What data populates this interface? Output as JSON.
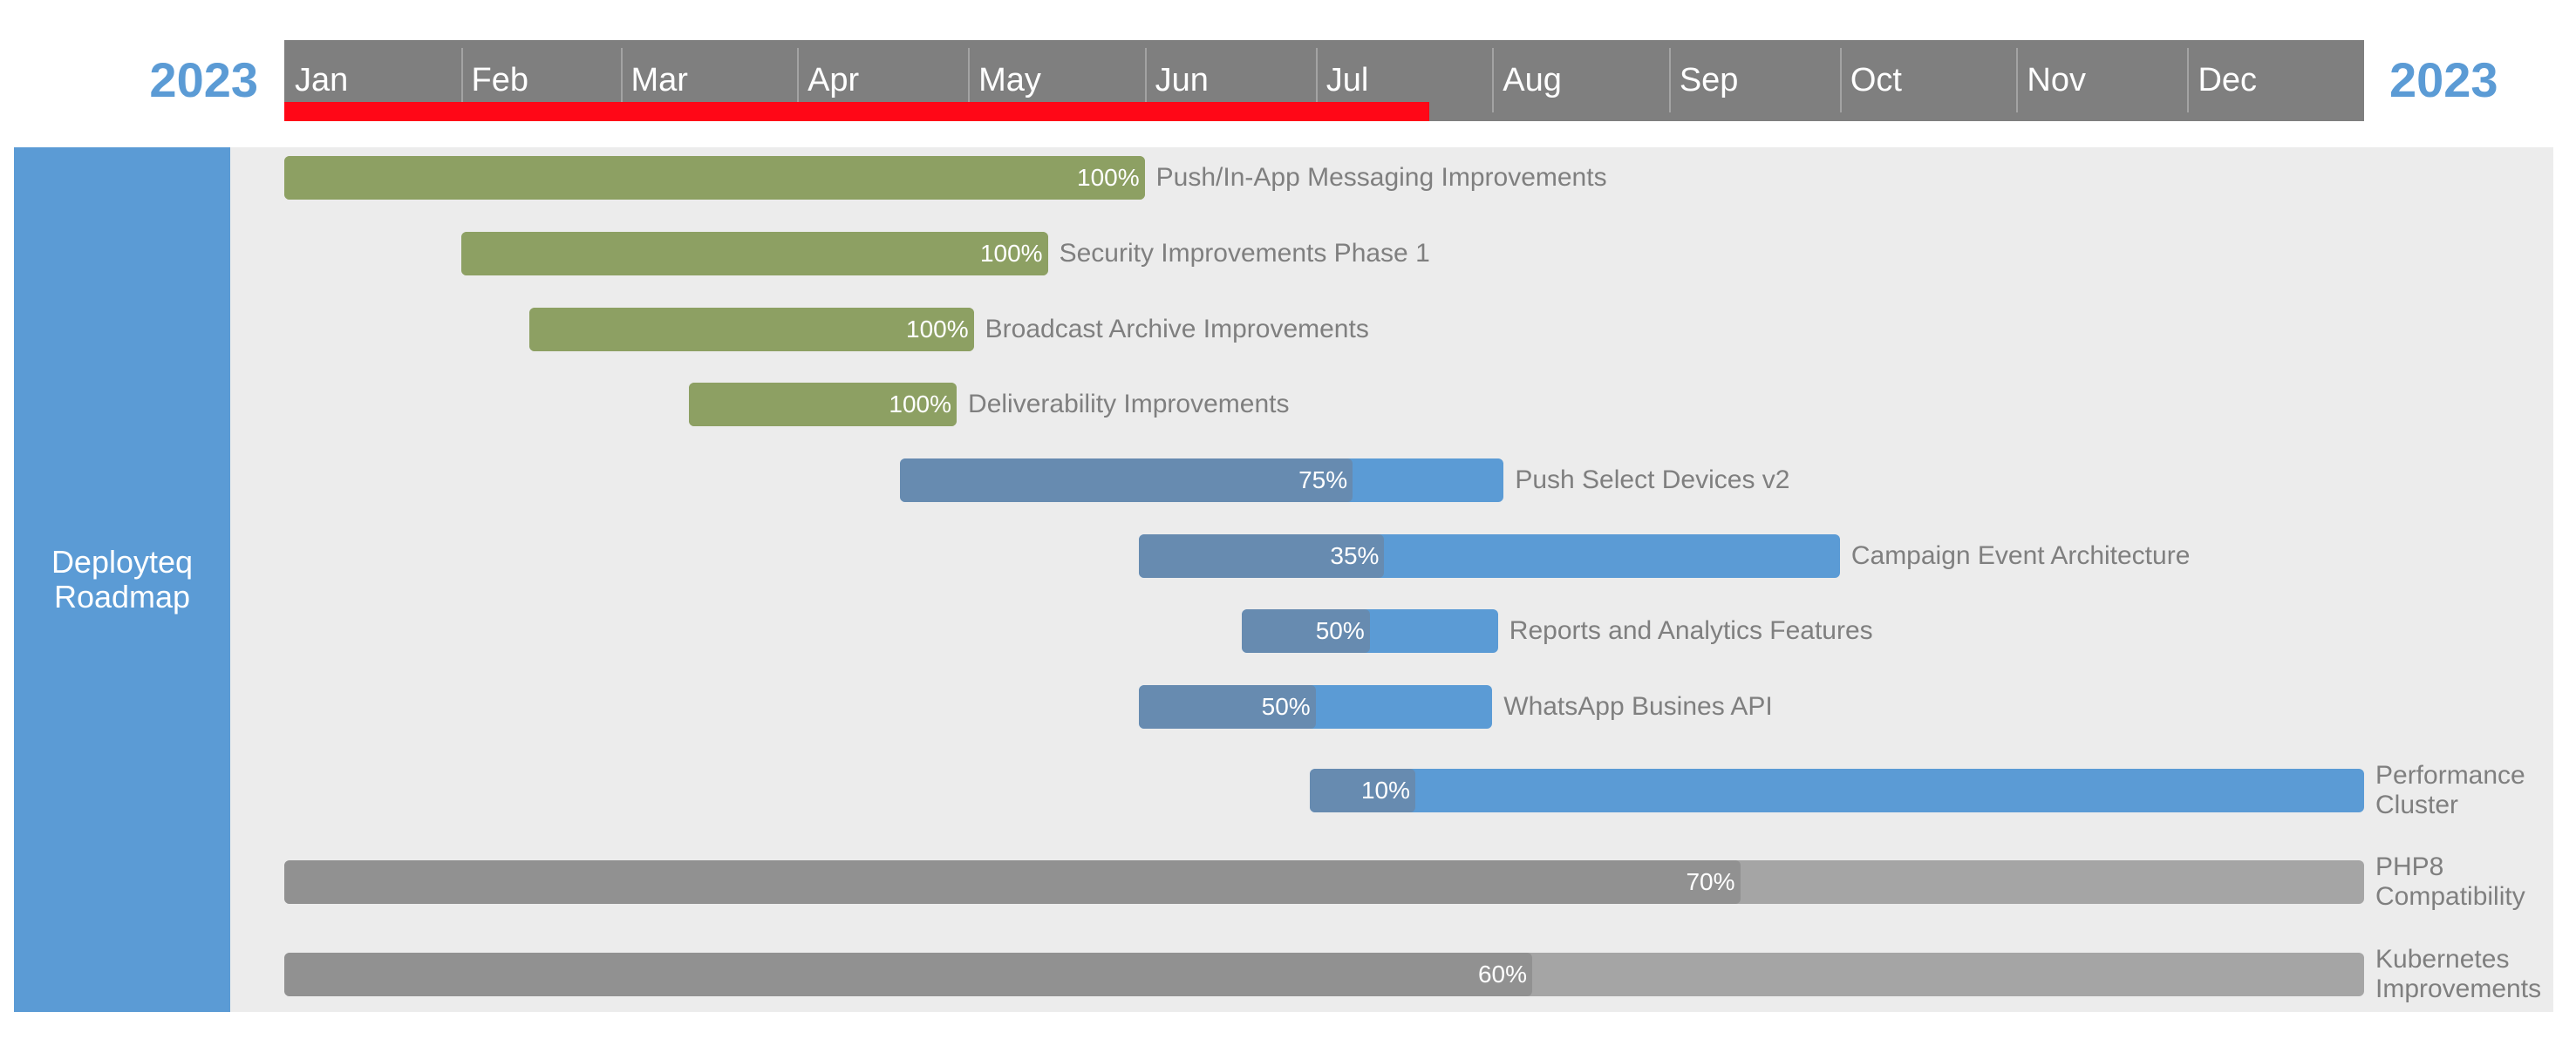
{
  "header": {
    "year_left": "2023",
    "year_right": "2023",
    "months": [
      "Jan",
      "Feb",
      "Mar",
      "Apr",
      "May",
      "Jun",
      "Jul",
      "Aug",
      "Sep",
      "Oct",
      "Nov",
      "Dec"
    ]
  },
  "swimlane": {
    "title": "Deployteq Roadmap"
  },
  "colors": {
    "year_text": "#5b9bd5",
    "timescale_bg": "#7f7f7f",
    "today_marker": "#ff0717",
    "swimlane_bg": "#5b9bd5",
    "rows_bg": "#ececec",
    "label_text": "#7f7f7f",
    "green": "#8da063",
    "blue_light": "#5b9bd5",
    "blue_dark": "#678bb0",
    "gray_light": "#a5a5a5",
    "gray_dark": "#919191"
  },
  "chart_data": {
    "type": "gantt",
    "title": "Deployteq Roadmap",
    "year": 2023,
    "x_range": [
      "2023-01-01",
      "2023-12-31"
    ],
    "x_ticks": [
      "Jan",
      "Feb",
      "Mar",
      "Apr",
      "May",
      "Jun",
      "Jul",
      "Aug",
      "Sep",
      "Oct",
      "Nov",
      "Dec"
    ],
    "today": "2023-07-20",
    "tasks": [
      {
        "name": "Push/In-App Messaging Improvements",
        "label_lines": [
          "Push/In-App Messaging Improvements"
        ],
        "start": "2023-01-01",
        "end": "2023-05-31",
        "progress": 100,
        "progress_label": "100%",
        "color": "green"
      },
      {
        "name": "Security Improvements Phase 1",
        "label_lines": [
          "Security Improvements Phase 1"
        ],
        "start": "2023-02-01",
        "end": "2023-05-14",
        "progress": 100,
        "progress_label": "100%",
        "color": "green"
      },
      {
        "name": "Broadcast Archive Improvements",
        "label_lines": [
          "Broadcast Archive Improvements"
        ],
        "start": "2023-02-13",
        "end": "2023-05-01",
        "progress": 100,
        "progress_label": "100%",
        "color": "green"
      },
      {
        "name": "Deliverability Improvements",
        "label_lines": [
          "Deliverability Improvements"
        ],
        "start": "2023-03-13",
        "end": "2023-04-28",
        "progress": 100,
        "progress_label": "100%",
        "color": "green"
      },
      {
        "name": "Push Select Devices v2",
        "label_lines": [
          "Push Select Devices v2"
        ],
        "start": "2023-04-19",
        "end": "2023-08-02",
        "progress": 75,
        "progress_label": "75%",
        "color": "blue"
      },
      {
        "name": "Campaign Event Architecture",
        "label_lines": [
          "Campaign Event Architecture"
        ],
        "start": "2023-05-31",
        "end": "2023-09-30",
        "progress": 35,
        "progress_label": "35%",
        "color": "blue"
      },
      {
        "name": "Reports and Analytics Features",
        "label_lines": [
          "Reports and Analytics Features"
        ],
        "start": "2023-06-18",
        "end": "2023-08-01",
        "progress": 50,
        "progress_label": "50%",
        "color": "blue"
      },
      {
        "name": "WhatsApp Busines API",
        "label_lines": [
          "WhatsApp Busines API"
        ],
        "start": "2023-05-31",
        "end": "2023-07-31",
        "progress": 50,
        "progress_label": "50%",
        "color": "blue"
      },
      {
        "name": "Performance Cluster",
        "label_lines": [
          "Performance",
          "Cluster"
        ],
        "start": "2023-06-30",
        "end": "2023-12-31",
        "progress": 10,
        "progress_label": "10%",
        "color": "blue"
      },
      {
        "name": "PHP8 Compatibility",
        "label_lines": [
          "PHP8",
          "Compatibility"
        ],
        "start": "2023-01-01",
        "end": "2023-12-31",
        "progress": 70,
        "progress_label": "70%",
        "color": "gray"
      },
      {
        "name": "Kubernetes Improvements",
        "label_lines": [
          "Kubernetes",
          "Improvements"
        ],
        "start": "2023-01-01",
        "end": "2023-12-31",
        "progress": 60,
        "progress_label": "60%",
        "color": "gray"
      }
    ]
  }
}
